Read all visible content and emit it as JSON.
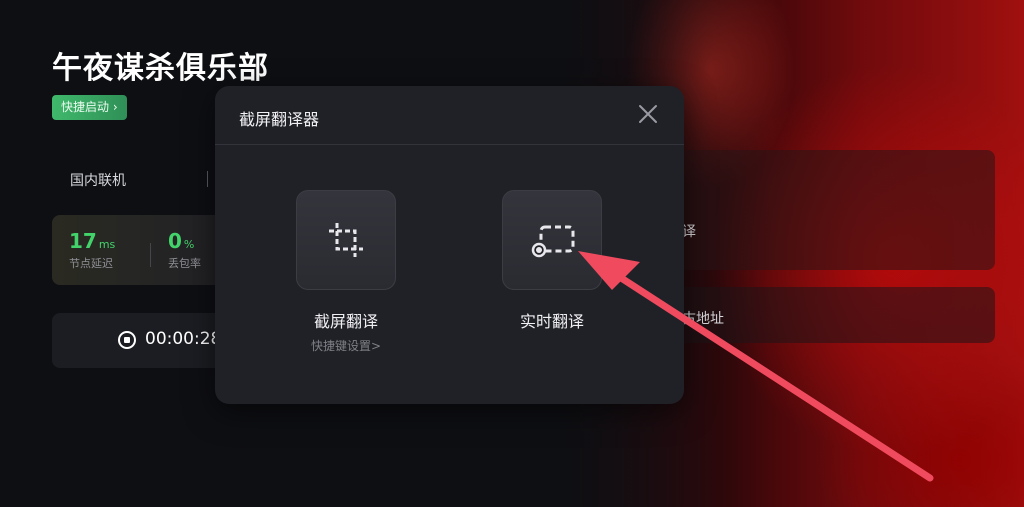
{
  "game": {
    "title": "午夜谋杀俱乐部",
    "quick_start": "快捷启动 ›",
    "mode": "国内联机"
  },
  "stats": {
    "latency_value": "17",
    "latency_unit": "ms",
    "latency_label": "节点延迟",
    "loss_value": "0",
    "loss_unit": "%",
    "loss_label": "丢包率"
  },
  "timer": {
    "elapsed": "00:00:28"
  },
  "right_panel": {
    "item1_partial": "译",
    "item2_partial": "古地址"
  },
  "dialog": {
    "title": "截屏翻译器",
    "screenshot_translate": {
      "label": "截屏翻译",
      "hotkey_link": "快捷键设置>"
    },
    "realtime_translate": {
      "label": "实时翻译"
    }
  },
  "colors": {
    "accent_green": "#43d36b",
    "arrow_red": "#f04a5e",
    "dialog_bg": "#202127"
  },
  "icons": {
    "close": "close-icon",
    "crop": "crop-icon",
    "region_select": "region-select-icon",
    "stop": "stop-icon"
  }
}
